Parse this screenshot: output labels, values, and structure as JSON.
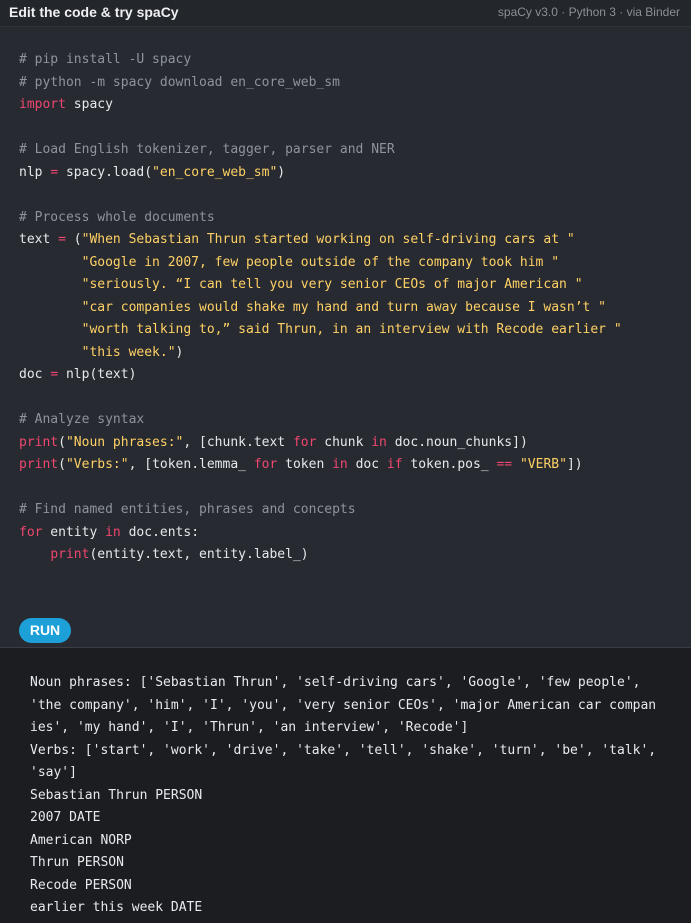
{
  "header": {
    "title": "Edit the code & try spaCy",
    "meta": "spaCy v3.0 · Python 3 · via Binder"
  },
  "code": {
    "lines": [
      [
        {
          "t": "# pip install -U spacy",
          "c": "c"
        }
      ],
      [
        {
          "t": "# python -m spacy download en_core_web_sm",
          "c": "c"
        }
      ],
      [
        {
          "t": "import",
          "c": "k"
        },
        {
          "t": " spacy",
          "c": ""
        }
      ],
      [],
      [
        {
          "t": "# Load English tokenizer, tagger, parser and NER",
          "c": "c"
        }
      ],
      [
        {
          "t": "nlp ",
          "c": ""
        },
        {
          "t": "=",
          "c": "o"
        },
        {
          "t": " spacy.load(",
          "c": ""
        },
        {
          "t": "\"en_core_web_sm\"",
          "c": "s"
        },
        {
          "t": ")",
          "c": ""
        }
      ],
      [],
      [
        {
          "t": "# Process whole documents",
          "c": "c"
        }
      ],
      [
        {
          "t": "text ",
          "c": ""
        },
        {
          "t": "=",
          "c": "o"
        },
        {
          "t": " (",
          "c": ""
        },
        {
          "t": "\"When Sebastian Thrun started working on self-driving cars at \"",
          "c": "s"
        }
      ],
      [
        {
          "t": "        \"Google in 2007, few people outside of the company took him \"",
          "c": "s"
        }
      ],
      [
        {
          "t": "        \"seriously. “I can tell you very senior CEOs of major American \"",
          "c": "s"
        }
      ],
      [
        {
          "t": "        \"car companies would shake my hand and turn away because I wasn’t \"",
          "c": "s"
        }
      ],
      [
        {
          "t": "        \"worth talking to,” said Thrun, in an interview with Recode earlier \"",
          "c": "s"
        }
      ],
      [
        {
          "t": "        \"this week.\"",
          "c": "s"
        },
        {
          "t": ")",
          "c": ""
        }
      ],
      [
        {
          "t": "doc ",
          "c": ""
        },
        {
          "t": "=",
          "c": "o"
        },
        {
          "t": " nlp(text)",
          "c": ""
        }
      ],
      [],
      [
        {
          "t": "# Analyze syntax",
          "c": "c"
        }
      ],
      [
        {
          "t": "print",
          "c": "f"
        },
        {
          "t": "(",
          "c": ""
        },
        {
          "t": "\"Noun phrases:\"",
          "c": "s"
        },
        {
          "t": ", [chunk.text ",
          "c": ""
        },
        {
          "t": "for",
          "c": "k"
        },
        {
          "t": " chunk ",
          "c": ""
        },
        {
          "t": "in",
          "c": "k"
        },
        {
          "t": " doc.noun_chunks])",
          "c": ""
        }
      ],
      [
        {
          "t": "print",
          "c": "f"
        },
        {
          "t": "(",
          "c": ""
        },
        {
          "t": "\"Verbs:\"",
          "c": "s"
        },
        {
          "t": ", [token.lemma_ ",
          "c": ""
        },
        {
          "t": "for",
          "c": "k"
        },
        {
          "t": " token ",
          "c": ""
        },
        {
          "t": "in",
          "c": "k"
        },
        {
          "t": " doc ",
          "c": ""
        },
        {
          "t": "if",
          "c": "k"
        },
        {
          "t": " token.pos_ ",
          "c": ""
        },
        {
          "t": "==",
          "c": "o"
        },
        {
          "t": " ",
          "c": ""
        },
        {
          "t": "\"VERB\"",
          "c": "s"
        },
        {
          "t": "])",
          "c": ""
        }
      ],
      [],
      [
        {
          "t": "# Find named entities, phrases and concepts",
          "c": "c"
        }
      ],
      [
        {
          "t": "for",
          "c": "k"
        },
        {
          "t": " entity ",
          "c": ""
        },
        {
          "t": "in",
          "c": "k"
        },
        {
          "t": " doc.ents:",
          "c": ""
        }
      ],
      [
        {
          "t": "    ",
          "c": ""
        },
        {
          "t": "print",
          "c": "f"
        },
        {
          "t": "(entity.text, entity.label_)",
          "c": ""
        }
      ]
    ]
  },
  "run_label": "RUN",
  "output": {
    "lines": [
      "Noun phrases: ['Sebastian Thrun', 'self-driving cars', 'Google', 'few people',",
      "'the company', 'him', 'I', 'you', 'very senior CEOs', 'major American car compan",
      "ies', 'my hand', 'I', 'Thrun', 'an interview', 'Recode']",
      "Verbs: ['start', 'work', 'drive', 'take', 'tell', 'shake', 'turn', 'be', 'talk',",
      "'say']",
      "Sebastian Thrun PERSON",
      "2007 DATE",
      "American NORP",
      "Thrun PERSON",
      "Recode PERSON",
      "earlier this week DATE"
    ]
  },
  "colors": {
    "comment": "#8d949c",
    "keyword": "#ef476f",
    "string": "#ffd166",
    "run_button": "#1d9fd8"
  }
}
